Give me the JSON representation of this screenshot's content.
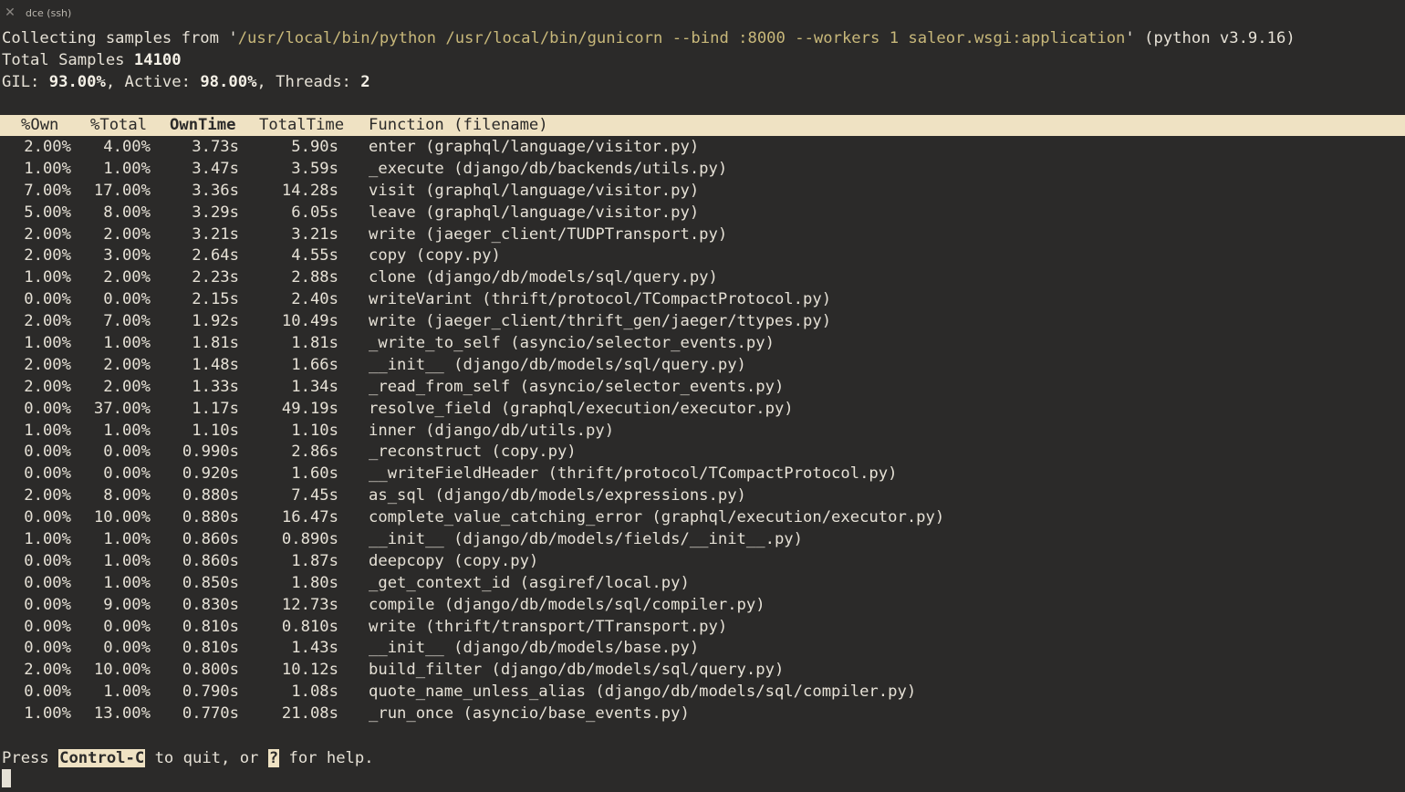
{
  "window": {
    "title": "dce (ssh)",
    "close_icon": "close-icon"
  },
  "info": {
    "collecting_prefix": "Collecting samples from '",
    "command": "/usr/local/bin/python /usr/local/bin/gunicorn --bind :8000 --workers 1 saleor.wsgi:application",
    "collecting_suffix": "' (python v3.9.16)",
    "total_samples_label": "Total Samples ",
    "total_samples_value": "14100",
    "gil_label": "GIL: ",
    "gil_value": "93.00%",
    "active_label": ", Active: ",
    "active_value": "98.00%",
    "threads_label": ", Threads: ",
    "threads_value": "2"
  },
  "table": {
    "headers": {
      "own": "%Own",
      "total": "%Total",
      "own_time": "OwnTime",
      "total_time": "TotalTime",
      "function": "Function (filename)"
    },
    "sorted_by": "OwnTime",
    "rows": [
      {
        "own": "2.00%",
        "total": "4.00%",
        "own_time": "3.73s",
        "total_time": "5.90s",
        "function": "enter (graphql/language/visitor.py)"
      },
      {
        "own": "1.00%",
        "total": "1.00%",
        "own_time": "3.47s",
        "total_time": "3.59s",
        "function": "_execute (django/db/backends/utils.py)"
      },
      {
        "own": "7.00%",
        "total": "17.00%",
        "own_time": "3.36s",
        "total_time": "14.28s",
        "function": "visit (graphql/language/visitor.py)"
      },
      {
        "own": "5.00%",
        "total": "8.00%",
        "own_time": "3.29s",
        "total_time": "6.05s",
        "function": "leave (graphql/language/visitor.py)"
      },
      {
        "own": "2.00%",
        "total": "2.00%",
        "own_time": "3.21s",
        "total_time": "3.21s",
        "function": "write (jaeger_client/TUDPTransport.py)"
      },
      {
        "own": "2.00%",
        "total": "3.00%",
        "own_time": "2.64s",
        "total_time": "4.55s",
        "function": "copy (copy.py)"
      },
      {
        "own": "1.00%",
        "total": "2.00%",
        "own_time": "2.23s",
        "total_time": "2.88s",
        "function": "clone (django/db/models/sql/query.py)"
      },
      {
        "own": "0.00%",
        "total": "0.00%",
        "own_time": "2.15s",
        "total_time": "2.40s",
        "function": "writeVarint (thrift/protocol/TCompactProtocol.py)"
      },
      {
        "own": "2.00%",
        "total": "7.00%",
        "own_time": "1.92s",
        "total_time": "10.49s",
        "function": "write (jaeger_client/thrift_gen/jaeger/ttypes.py)"
      },
      {
        "own": "1.00%",
        "total": "1.00%",
        "own_time": "1.81s",
        "total_time": "1.81s",
        "function": "_write_to_self (asyncio/selector_events.py)"
      },
      {
        "own": "2.00%",
        "total": "2.00%",
        "own_time": "1.48s",
        "total_time": "1.66s",
        "function": "__init__ (django/db/models/sql/query.py)"
      },
      {
        "own": "2.00%",
        "total": "2.00%",
        "own_time": "1.33s",
        "total_time": "1.34s",
        "function": "_read_from_self (asyncio/selector_events.py)"
      },
      {
        "own": "0.00%",
        "total": "37.00%",
        "own_time": "1.17s",
        "total_time": "49.19s",
        "function": "resolve_field (graphql/execution/executor.py)"
      },
      {
        "own": "1.00%",
        "total": "1.00%",
        "own_time": "1.10s",
        "total_time": "1.10s",
        "function": "inner (django/db/utils.py)"
      },
      {
        "own": "0.00%",
        "total": "0.00%",
        "own_time": "0.990s",
        "total_time": "2.86s",
        "function": "_reconstruct (copy.py)"
      },
      {
        "own": "0.00%",
        "total": "0.00%",
        "own_time": "0.920s",
        "total_time": "1.60s",
        "function": "__writeFieldHeader (thrift/protocol/TCompactProtocol.py)"
      },
      {
        "own": "2.00%",
        "total": "8.00%",
        "own_time": "0.880s",
        "total_time": "7.45s",
        "function": "as_sql (django/db/models/expressions.py)"
      },
      {
        "own": "0.00%",
        "total": "10.00%",
        "own_time": "0.880s",
        "total_time": "16.47s",
        "function": "complete_value_catching_error (graphql/execution/executor.py)"
      },
      {
        "own": "1.00%",
        "total": "1.00%",
        "own_time": "0.860s",
        "total_time": "0.890s",
        "function": "__init__ (django/db/models/fields/__init__.py)"
      },
      {
        "own": "0.00%",
        "total": "1.00%",
        "own_time": "0.860s",
        "total_time": "1.87s",
        "function": "deepcopy (copy.py)"
      },
      {
        "own": "0.00%",
        "total": "1.00%",
        "own_time": "0.850s",
        "total_time": "1.80s",
        "function": "_get_context_id (asgiref/local.py)"
      },
      {
        "own": "0.00%",
        "total": "9.00%",
        "own_time": "0.830s",
        "total_time": "12.73s",
        "function": "compile (django/db/models/sql/compiler.py)"
      },
      {
        "own": "0.00%",
        "total": "0.00%",
        "own_time": "0.810s",
        "total_time": "0.810s",
        "function": "write (thrift/transport/TTransport.py)"
      },
      {
        "own": "0.00%",
        "total": "0.00%",
        "own_time": "0.810s",
        "total_time": "1.43s",
        "function": "__init__ (django/db/models/base.py)"
      },
      {
        "own": "2.00%",
        "total": "10.00%",
        "own_time": "0.800s",
        "total_time": "10.12s",
        "function": "build_filter (django/db/models/sql/query.py)"
      },
      {
        "own": "0.00%",
        "total": "1.00%",
        "own_time": "0.790s",
        "total_time": "1.08s",
        "function": "quote_name_unless_alias (django/db/models/sql/compiler.py)"
      },
      {
        "own": "1.00%",
        "total": "13.00%",
        "own_time": "0.770s",
        "total_time": "21.08s",
        "function": "_run_once (asyncio/base_events.py)"
      }
    ]
  },
  "footer": {
    "press": "Press ",
    "key_quit": "Control-C",
    "mid": " to quit, or ",
    "key_help": "?",
    "end": " for help."
  },
  "colors": {
    "background": "#2b2a29",
    "header_bar": "#efe2c3",
    "text": "#e6e1d6",
    "path_text": "#c8b87a"
  }
}
